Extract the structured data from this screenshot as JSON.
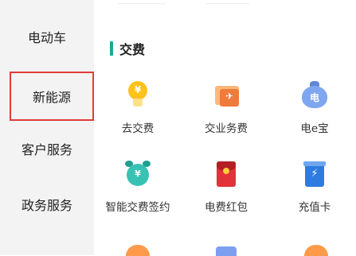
{
  "sidebar": {
    "items": [
      {
        "label": "电动车"
      },
      {
        "label": "新能源"
      },
      {
        "label": "客户服务"
      },
      {
        "label": "政务服务"
      }
    ]
  },
  "section": {
    "title": "交费",
    "accent_color": "#1aa894"
  },
  "tiles": [
    {
      "label": "去交费",
      "icon": "bulb-yen-icon",
      "symbol": "¥"
    },
    {
      "label": "交业务费",
      "icon": "paper-plane-icon",
      "symbol": "✈"
    },
    {
      "label": "电e宝",
      "icon": "money-bag-icon",
      "symbol": "电"
    },
    {
      "label": "智能交费签约",
      "icon": "alarm-clock-icon",
      "symbol": "¥"
    },
    {
      "label": "电费红包",
      "icon": "red-envelope-icon",
      "symbol": ""
    },
    {
      "label": "充值卡",
      "icon": "recharge-card-icon",
      "symbol": "⚡"
    }
  ],
  "selection_highlight_color": "#e23a3a"
}
